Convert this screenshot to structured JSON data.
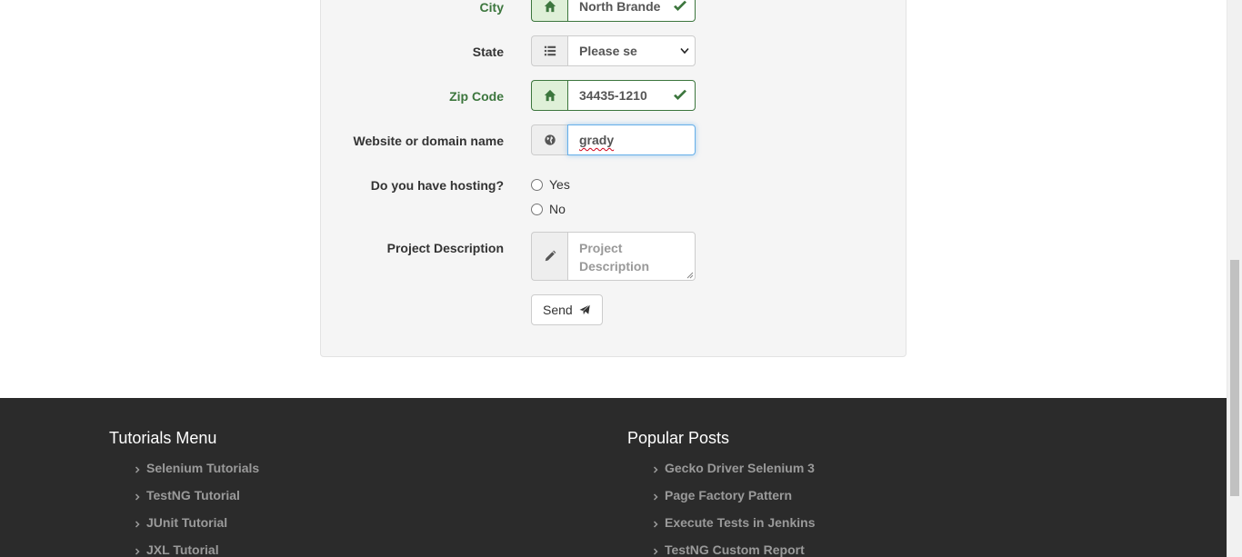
{
  "form": {
    "city": {
      "label": "City",
      "value": "North Brande"
    },
    "state": {
      "label": "State",
      "selected": "Please se"
    },
    "zip": {
      "label": "Zip Code",
      "value": "34435-1210"
    },
    "website": {
      "label": "Website or domain name",
      "value": "grady"
    },
    "hosting": {
      "label": "Do you have hosting?",
      "options": [
        "Yes",
        "No"
      ]
    },
    "project": {
      "label": "Project Description",
      "placeholder": "Project Description",
      "placeholder_lines": [
        "Project",
        "Description"
      ]
    },
    "send_label": "Send"
  },
  "footer": {
    "tutorials": {
      "title": "Tutorials Menu",
      "items": [
        "Selenium Tutorials",
        "TestNG Tutorial",
        "JUnit Tutorial",
        "JXL Tutorial"
      ]
    },
    "popular": {
      "title": "Popular Posts",
      "items": [
        "Gecko Driver Selenium 3",
        "Page Factory Pattern",
        "Execute Tests in Jenkins",
        "TestNG Custom Report"
      ]
    }
  },
  "colors": {
    "success": "#3c763d",
    "success_bg": "#dff0d8",
    "focus": "#66afe9",
    "footer_bg": "#2b2b2b"
  },
  "icons": {
    "city": "home-icon",
    "state": "list-icon",
    "zip": "home-icon",
    "website": "globe-icon",
    "project": "pencil-icon",
    "send": "paper-plane-icon",
    "valid": "check-icon"
  }
}
